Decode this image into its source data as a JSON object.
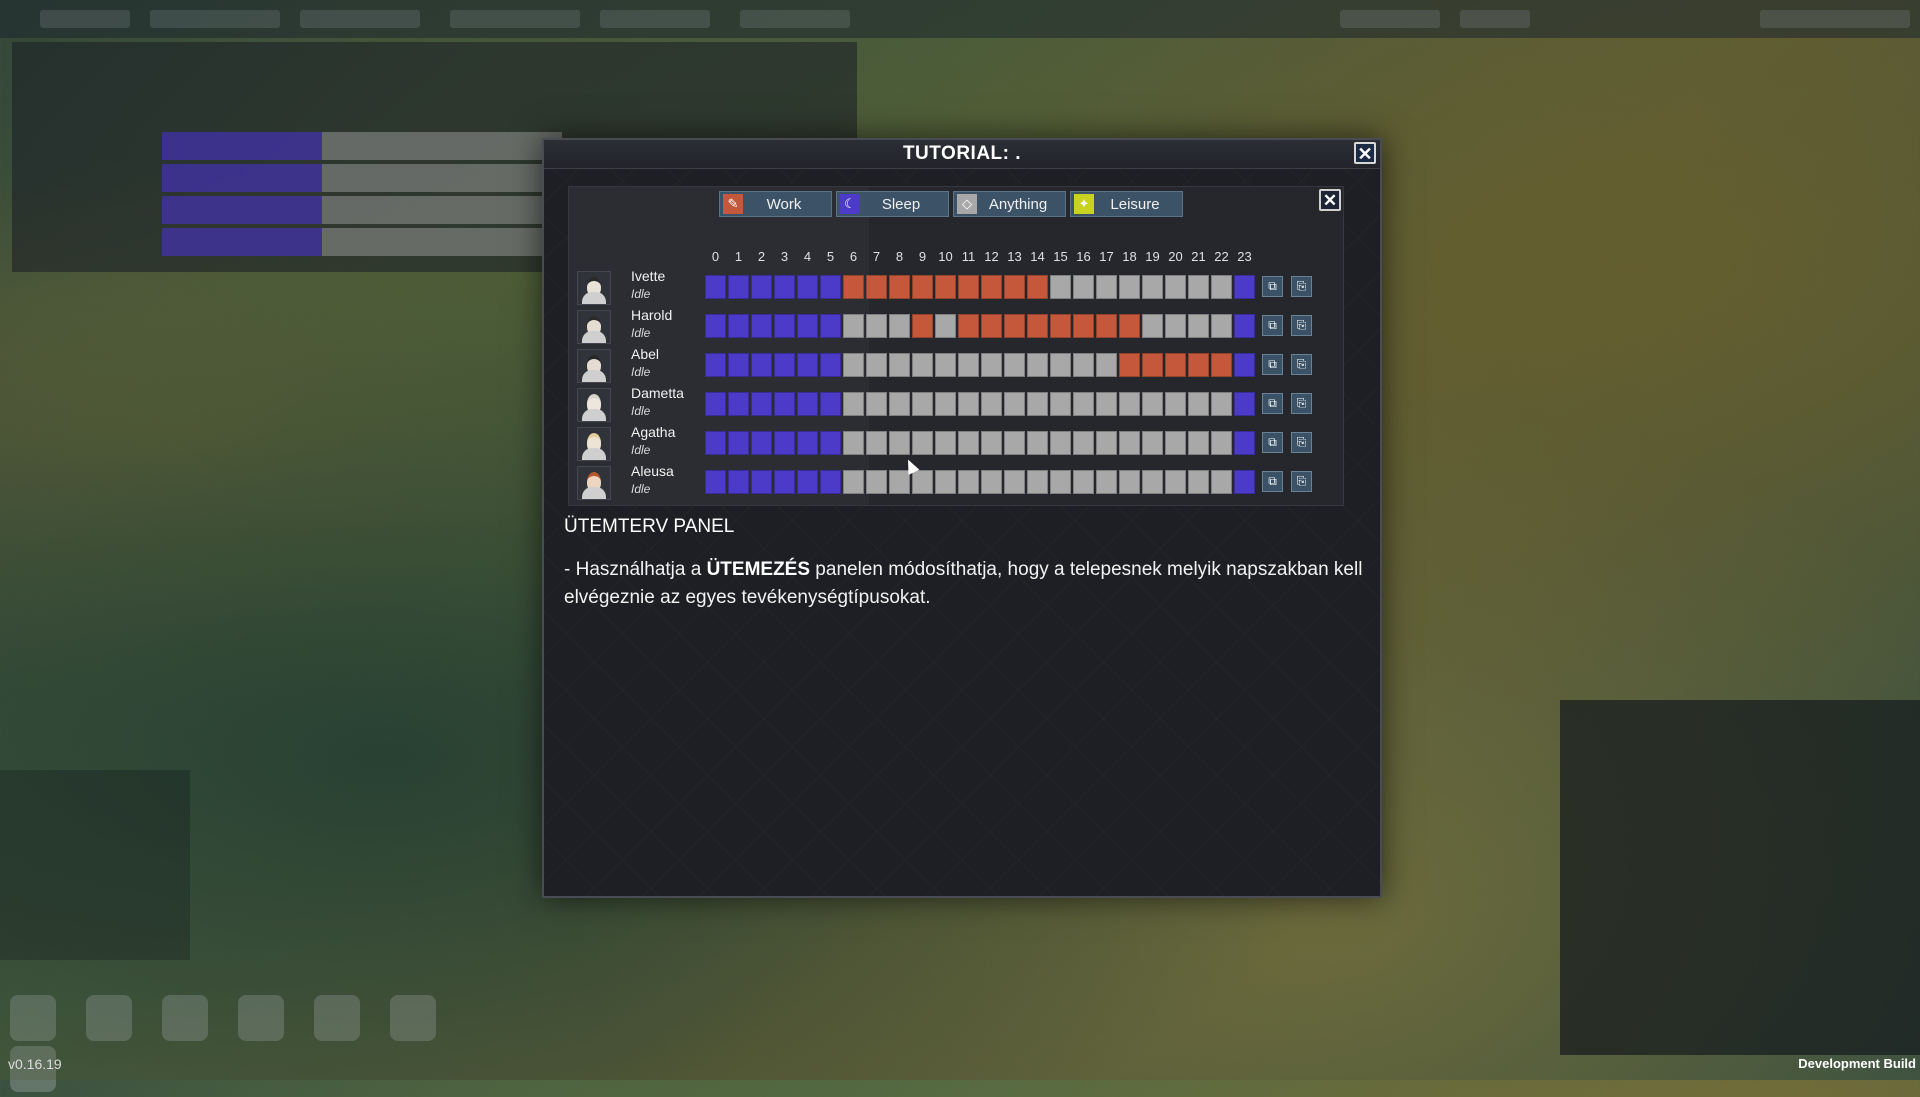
{
  "app": {
    "version": "v0.16.19",
    "build_label": "Development Build"
  },
  "dialog": {
    "title": "TUTORIAL: .",
    "close_icon": "close-icon"
  },
  "schedule": {
    "tabs": [
      {
        "label": "Work",
        "color": "#c5583a",
        "icon": "work-icon"
      },
      {
        "label": "Sleep",
        "color": "#4b3bc8",
        "icon": "sleep-icon"
      },
      {
        "label": "Anything",
        "color": "#a8a8a8",
        "icon": "anything-icon"
      },
      {
        "label": "Leisure",
        "color": "#c8d21f",
        "icon": "leisure-icon"
      }
    ],
    "hours": [
      "0",
      "1",
      "2",
      "3",
      "4",
      "5",
      "6",
      "7",
      "8",
      "9",
      "10",
      "11",
      "12",
      "13",
      "14",
      "15",
      "16",
      "17",
      "18",
      "19",
      "20",
      "21",
      "22",
      "23"
    ],
    "colors": {
      "S": "#4b3bc8",
      "W": "#c5583a",
      "A": "#a8a8a8"
    },
    "colonists": [
      {
        "name": "Ivette",
        "status": "Idle",
        "portrait": {
          "skin": "#e9e2d8",
          "hair": "#2a2a2a"
        },
        "slots": [
          "S",
          "S",
          "S",
          "S",
          "S",
          "S",
          "W",
          "W",
          "W",
          "W",
          "W",
          "W",
          "W",
          "W",
          "W",
          "A",
          "A",
          "A",
          "A",
          "A",
          "A",
          "A",
          "A",
          "S"
        ]
      },
      {
        "name": "Harold",
        "status": "Idle",
        "portrait": {
          "skin": "#e6ddd2",
          "hair": "#2b2b2b"
        },
        "slots": [
          "S",
          "S",
          "S",
          "S",
          "S",
          "S",
          "A",
          "A",
          "A",
          "W",
          "A",
          "W",
          "W",
          "W",
          "W",
          "W",
          "W",
          "W",
          "W",
          "A",
          "A",
          "A",
          "A",
          "S"
        ]
      },
      {
        "name": "Abel",
        "status": "Idle",
        "portrait": {
          "skin": "#e4dcd2",
          "hair": "#262626"
        },
        "slots": [
          "S",
          "S",
          "S",
          "S",
          "S",
          "S",
          "A",
          "A",
          "A",
          "A",
          "A",
          "A",
          "A",
          "A",
          "A",
          "A",
          "A",
          "A",
          "W",
          "W",
          "W",
          "W",
          "W",
          "S"
        ]
      },
      {
        "name": "Dametta",
        "status": "Idle",
        "portrait": {
          "skin": "#ece6dd",
          "hair": "#d9d4cc"
        },
        "slots": [
          "S",
          "S",
          "S",
          "S",
          "S",
          "S",
          "A",
          "A",
          "A",
          "A",
          "A",
          "A",
          "A",
          "A",
          "A",
          "A",
          "A",
          "A",
          "A",
          "A",
          "A",
          "A",
          "A",
          "S"
        ]
      },
      {
        "name": "Agatha",
        "status": "Idle",
        "portrait": {
          "skin": "#eee4d6",
          "hair": "#e4cf9a"
        },
        "slots": [
          "S",
          "S",
          "S",
          "S",
          "S",
          "S",
          "A",
          "A",
          "A",
          "A",
          "A",
          "A",
          "A",
          "A",
          "A",
          "A",
          "A",
          "A",
          "A",
          "A",
          "A",
          "A",
          "A",
          "S"
        ]
      },
      {
        "name": "Aleusa",
        "status": "Idle",
        "portrait": {
          "skin": "#ecd6c2",
          "hair": "#b5582d"
        },
        "slots": [
          "S",
          "S",
          "S",
          "S",
          "S",
          "S",
          "A",
          "A",
          "A",
          "A",
          "A",
          "A",
          "A",
          "A",
          "A",
          "A",
          "A",
          "A",
          "A",
          "A",
          "A",
          "A",
          "A",
          "S"
        ]
      }
    ],
    "row_buttons": [
      "copy-icon",
      "paste-icon"
    ]
  },
  "content": {
    "heading": "ÜTEMTERV PANEL",
    "body_prefix": "- Használhatja a ",
    "body_bold": "ÜTEMEZÉS",
    "body_suffix": " panelen módosíthatja, hogy a telepesnek melyik napszakban kell elvégeznie az egyes tevékenységtípusokat."
  }
}
